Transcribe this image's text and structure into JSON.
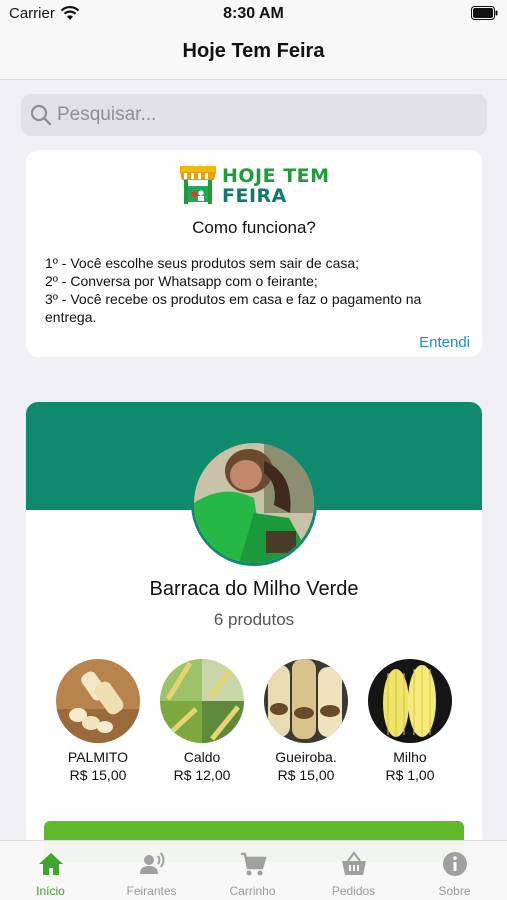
{
  "status_bar": {
    "carrier": "Carrier",
    "time": "8:30 AM"
  },
  "nav": {
    "title": "Hoje Tem Feira"
  },
  "search": {
    "placeholder": "Pesquisar..."
  },
  "info_card": {
    "logo_line1": "HOJE TEM",
    "logo_line2": "FEIRA",
    "title": "Como funciona?",
    "steps": [
      "1º - Você escolhe seus produtos sem sair de casa;",
      "2º - Conversa por Whatsapp com o feirante;",
      "3º - Você recebe os produtos em casa e faz o pagamento na entrega."
    ],
    "dismiss_label": "Entendi"
  },
  "vendor": {
    "name": "Barraca do Milho Verde",
    "product_count": "6 produtos",
    "products": [
      {
        "name": "PALMITO",
        "price": "R$ 15,00"
      },
      {
        "name": "Caldo",
        "price": "R$ 12,00"
      },
      {
        "name": "Gueiroba.",
        "price": "R$ 15,00"
      },
      {
        "name": "Milho",
        "price": "R$ 1,00"
      }
    ],
    "enter_label": ""
  },
  "tabs": [
    {
      "label": "Início",
      "icon": "home-icon",
      "active": true
    },
    {
      "label": "Feirantes",
      "icon": "vendor-icon",
      "active": false
    },
    {
      "label": "Carrinho",
      "icon": "cart-icon",
      "active": false
    },
    {
      "label": "Pedidos",
      "icon": "basket-icon",
      "active": false
    },
    {
      "label": "Sobre",
      "icon": "info-icon",
      "active": false
    }
  ],
  "colors": {
    "brand_green": "#0f8a6e",
    "accent_green": "#3ea42e",
    "button_green": "#62b82b",
    "link_blue": "#1a8fd8"
  }
}
